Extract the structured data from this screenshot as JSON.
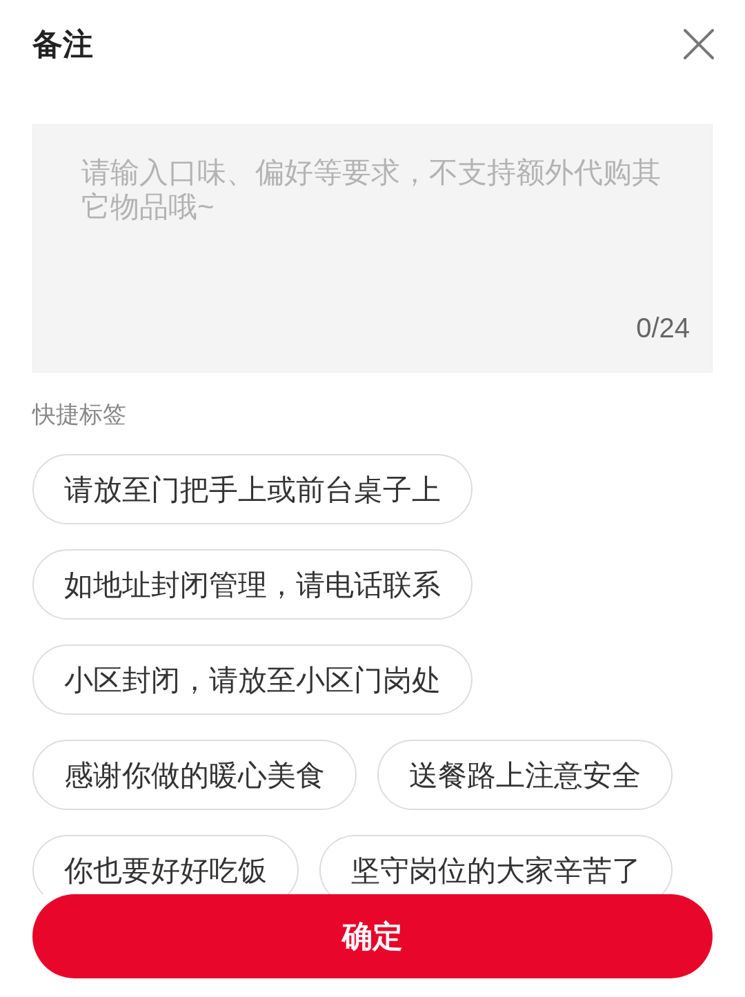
{
  "header": {
    "title": "备注"
  },
  "remark_field": {
    "placeholder": "请输入口味、偏好等要求，不支持额外代购其它物品哦~",
    "counter": "0/24"
  },
  "quick_tags": {
    "heading": "快捷标签",
    "tags": [
      "请放至门把手上或前台桌子上",
      "如地址封闭管理，请电话联系",
      "小区封闭，请放至小区门岗处",
      "感谢你做的暖心美食",
      "送餐路上注意安全",
      "你也要好好吃饭",
      "坚守岗位的大家辛苦了"
    ]
  },
  "confirm_button": {
    "label": "确定"
  }
}
